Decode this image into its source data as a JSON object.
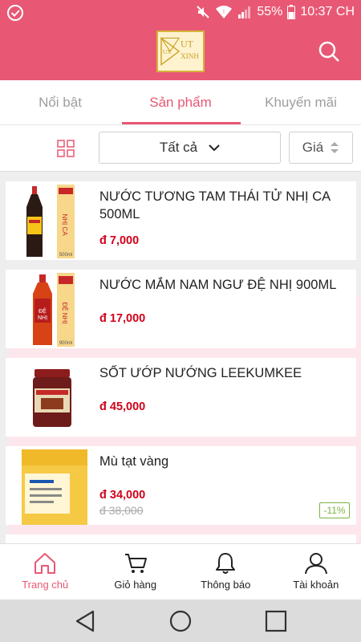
{
  "status_bar": {
    "battery": "55%",
    "time": "10:37 CH"
  },
  "header": {
    "logo": {
      "letters_left": "UX",
      "text_top": "UT",
      "text_bottom": "XINH"
    }
  },
  "tabs": [
    {
      "label": "Nổi bật",
      "active": false
    },
    {
      "label": "Sản phẩm",
      "active": true
    },
    {
      "label": "Khuyến mãi",
      "active": false
    }
  ],
  "toolbar": {
    "filter_value": "Tất cả",
    "sort_label": "Giá"
  },
  "products": [
    {
      "name": "NƯỚC TƯƠNG TAM THÁI TỬ NHỊ CA 500ML",
      "price": "đ 7,000"
    },
    {
      "name": "NƯỚC MẮM NAM NGƯ ĐỆ NHỊ 900ML",
      "price": "đ 17,000"
    },
    {
      "name": "SỐT ƯỚP NƯỚNG LEEKUMKEE",
      "price": "đ 45,000"
    },
    {
      "name": "Mù tạt vàng",
      "price": "đ 34,000",
      "old_price": "đ 38,000",
      "discount": "-11%"
    }
  ],
  "bottom_nav": [
    {
      "label": "Trang chủ",
      "icon": "home-icon",
      "active": true
    },
    {
      "label": "Giỏ hàng",
      "icon": "cart-icon",
      "active": false
    },
    {
      "label": "Thông báo",
      "icon": "bell-icon",
      "active": false
    },
    {
      "label": "Tài khoản",
      "icon": "user-icon",
      "active": false
    }
  ],
  "colors": {
    "brand": "#e85874",
    "price": "#d0021b",
    "discount": "#7cb342"
  }
}
